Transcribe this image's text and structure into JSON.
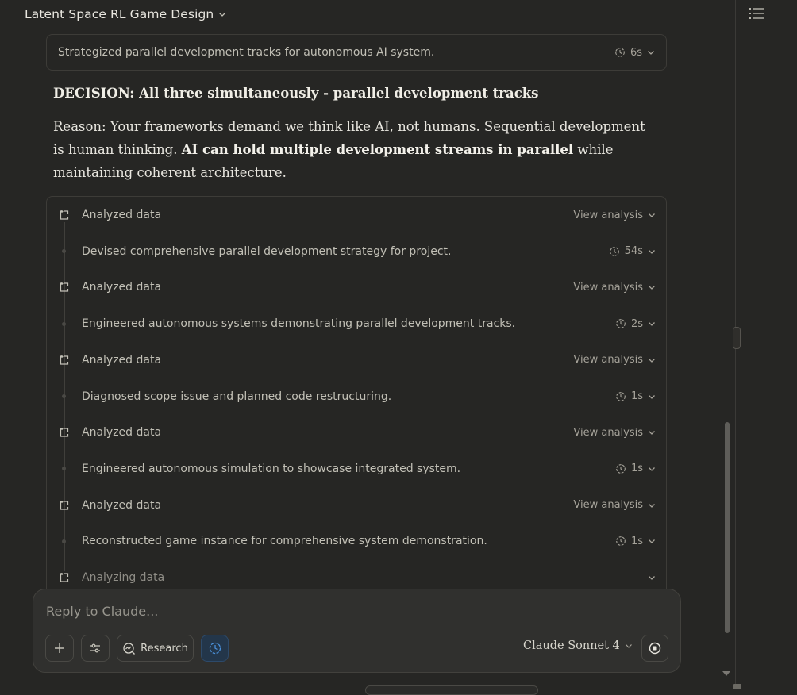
{
  "header": {
    "title": "Latent Space RL Game Design"
  },
  "thinking": {
    "text": "Strategized parallel development tracks for autonomous AI system.",
    "time": "6s"
  },
  "message": {
    "decision": "DECISION: All three simultaneously - parallel development tracks",
    "reason_part1": "Reason: Your frameworks demand we think like AI, not humans. Sequential development is human thinking. ",
    "reason_bold": "AI can hold multiple development streams in parallel",
    "reason_part2": " while maintaining coherent architecture."
  },
  "steps": [
    {
      "kind": "analysis",
      "label": "Analyzed data",
      "right": "View analysis"
    },
    {
      "kind": "thought",
      "label": "Devised comprehensive parallel development strategy for project.",
      "right": "54s"
    },
    {
      "kind": "analysis",
      "label": "Analyzed data",
      "right": "View analysis"
    },
    {
      "kind": "thought",
      "label": "Engineered autonomous systems demonstrating parallel development tracks.",
      "right": "2s"
    },
    {
      "kind": "analysis",
      "label": "Analyzed data",
      "right": "View analysis"
    },
    {
      "kind": "thought",
      "label": "Diagnosed scope issue and planned code restructuring.",
      "right": "1s"
    },
    {
      "kind": "analysis",
      "label": "Analyzed data",
      "right": "View analysis"
    },
    {
      "kind": "thought",
      "label": "Engineered autonomous simulation to showcase integrated system.",
      "right": "1s"
    },
    {
      "kind": "analysis",
      "label": "Analyzed data",
      "right": "View analysis"
    },
    {
      "kind": "thought",
      "label": "Reconstructed game instance for comprehensive system demonstration.",
      "right": "1s"
    },
    {
      "kind": "pending",
      "label": "Analyzing data",
      "right": ""
    }
  ],
  "composer": {
    "placeholder": "Reply to Claude...",
    "research_label": "Research",
    "model": "Claude Sonnet 4"
  },
  "colors": {
    "accent_active": "#23364a",
    "background": "#262624"
  }
}
